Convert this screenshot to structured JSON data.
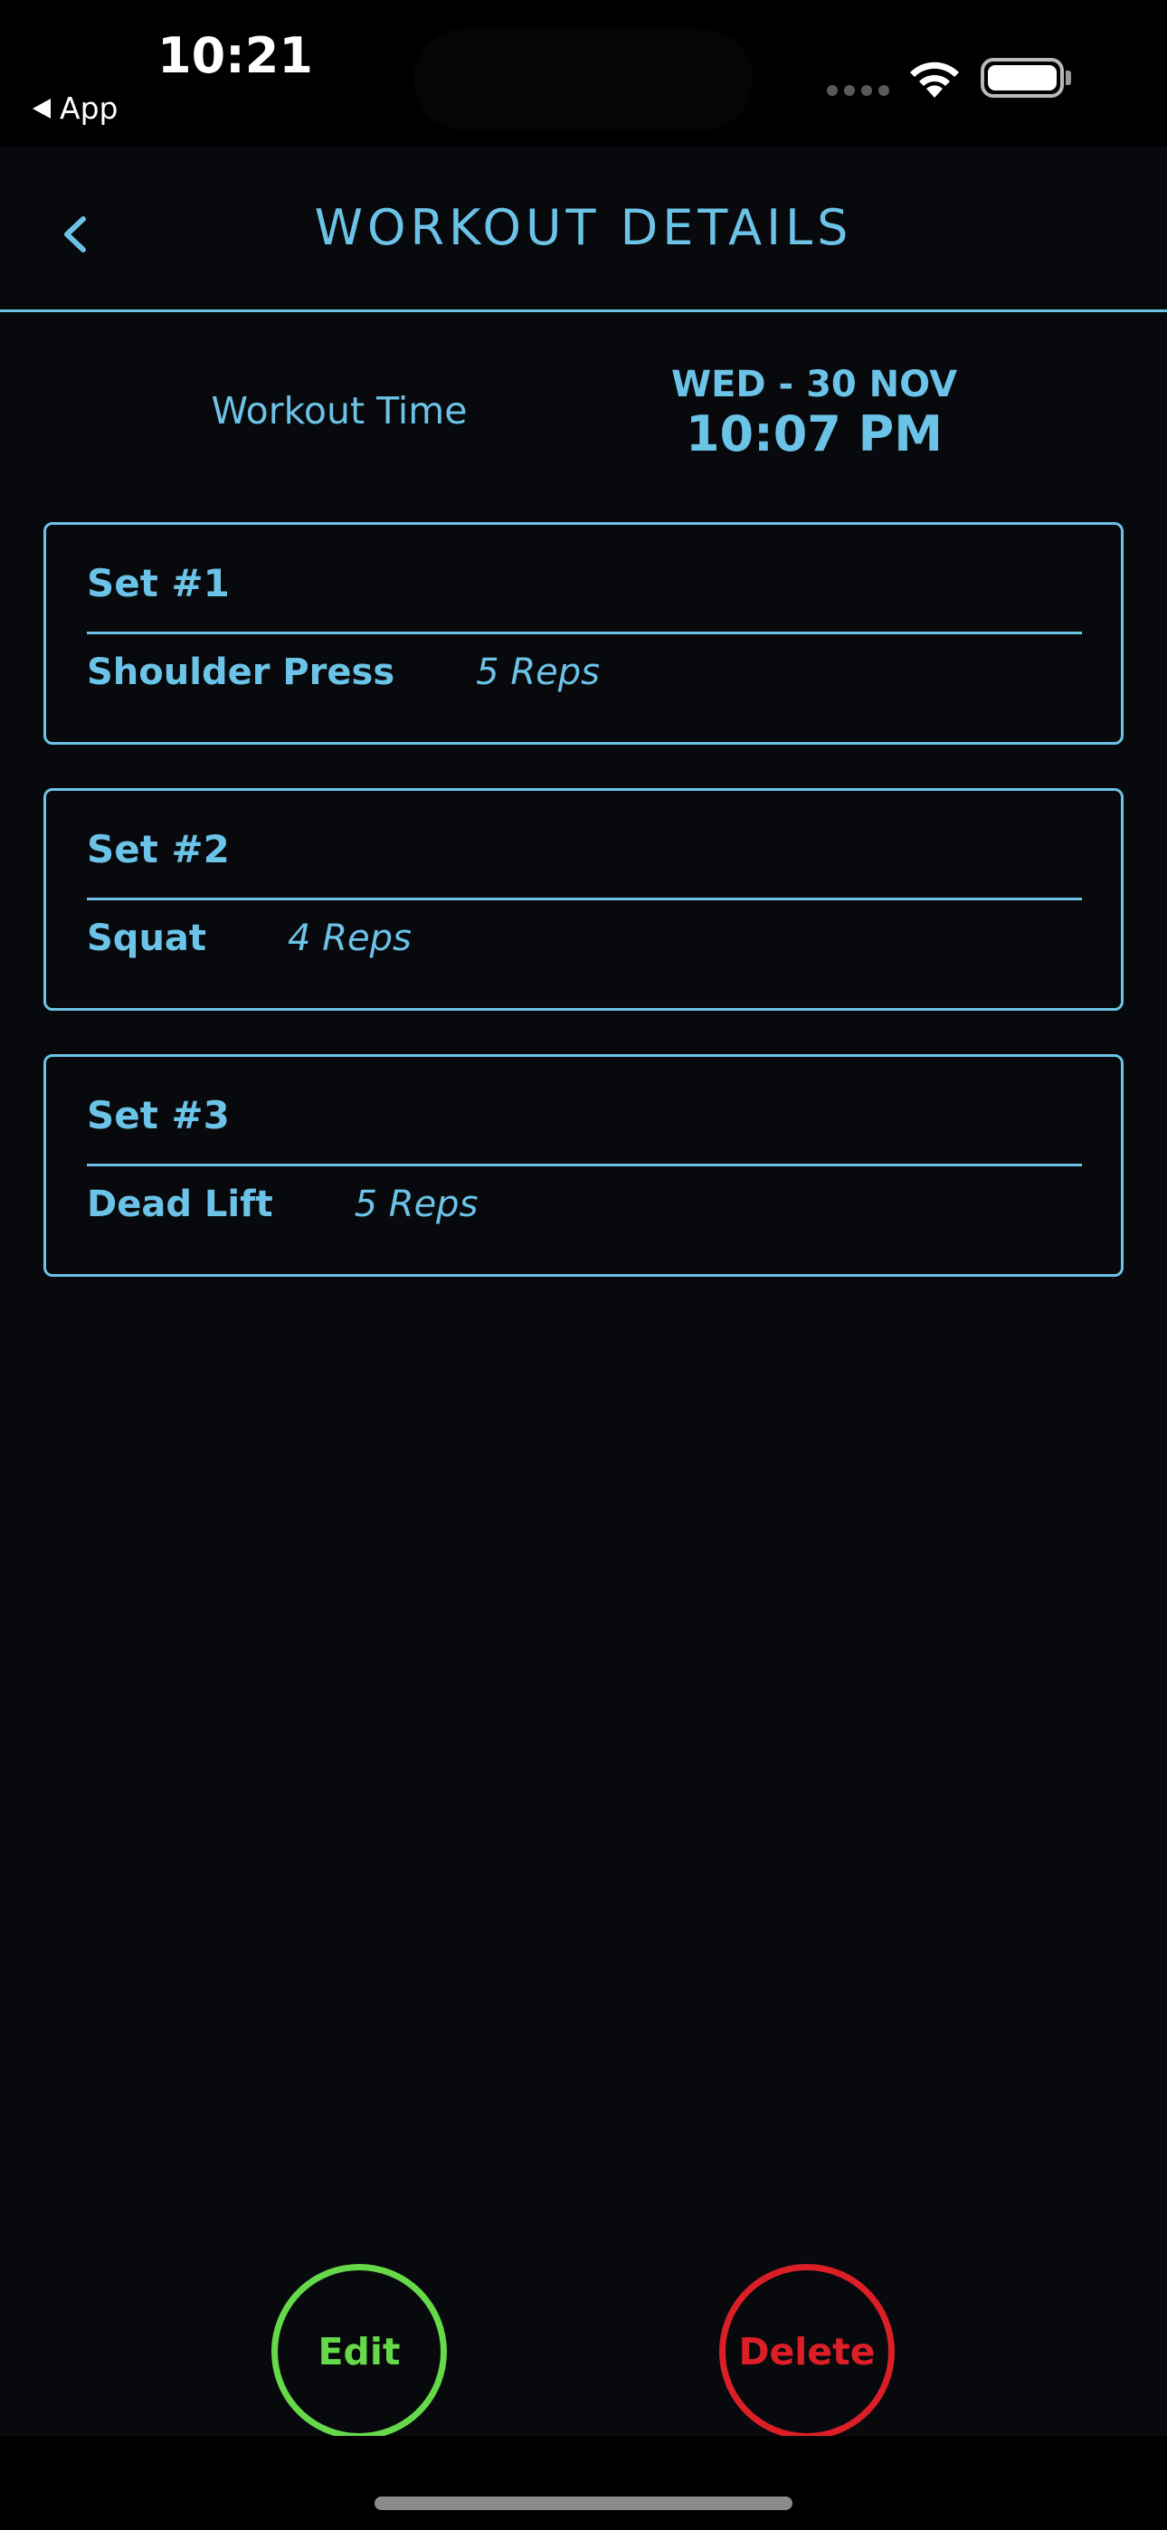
{
  "status_bar": {
    "time": "10:21",
    "back_app_label": "App",
    "icons": [
      "signal-icon",
      "wifi-icon",
      "battery-icon"
    ]
  },
  "nav": {
    "title": "WORKOUT DETAILS",
    "back_icon": "chevron-left-icon"
  },
  "workout_time": {
    "label": "Workout Time",
    "date": "WED - 30 NOV",
    "time": "10:07 PM"
  },
  "sets": [
    {
      "title": "Set #1",
      "exercise": "Shoulder Press",
      "reps": "5 Reps"
    },
    {
      "title": "Set #2",
      "exercise": "Squat",
      "reps": "4 Reps"
    },
    {
      "title": "Set #3",
      "exercise": "Dead Lift",
      "reps": "5 Reps"
    }
  ],
  "actions": {
    "edit_label": "Edit",
    "delete_label": "Delete"
  },
  "colors": {
    "accent": "#6cc3e8",
    "edit": "#66d94a",
    "delete": "#dc1f27",
    "background": "#08090c"
  }
}
